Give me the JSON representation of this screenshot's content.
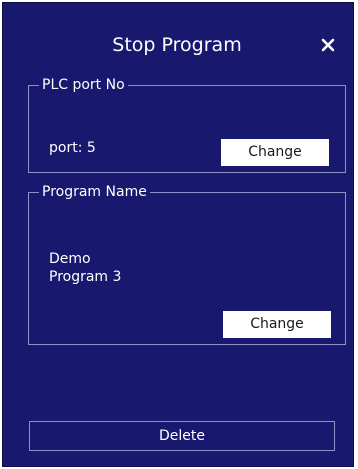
{
  "dialog": {
    "title": "Stop Program",
    "close_icon": "close-icon",
    "background_color": "#18186e",
    "border_color": "#8f90c4"
  },
  "plc_port": {
    "legend": "PLC port No",
    "value_text": "port: 5",
    "change_label": "Change"
  },
  "program": {
    "legend": "Program Name",
    "value_text": "Demo\nProgram 3",
    "change_label": "Change"
  },
  "footer": {
    "delete_label": "Delete"
  }
}
